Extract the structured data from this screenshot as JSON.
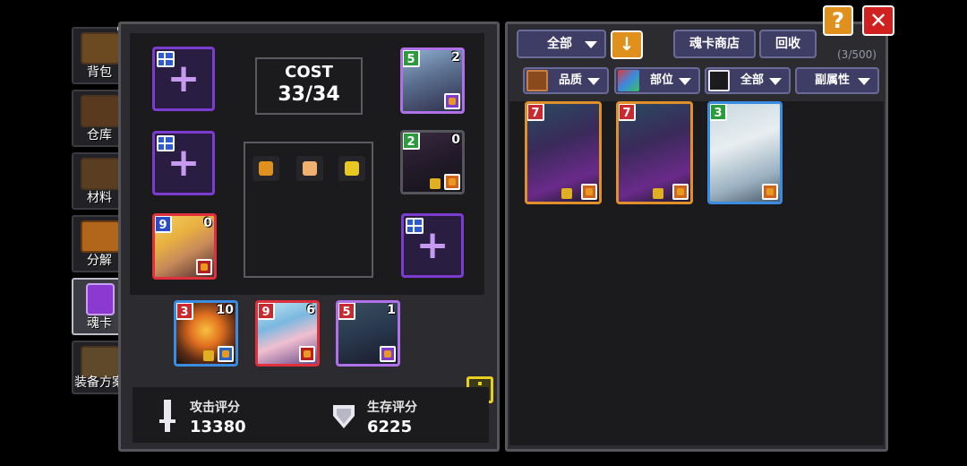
{
  "tabs": [
    {
      "label": "背包",
      "icon": "backpack-icon",
      "active": false
    },
    {
      "label": "仓库",
      "icon": "warehouse-chest-icon",
      "active": false
    },
    {
      "label": "材料",
      "icon": "materials-icon",
      "active": false
    },
    {
      "label": "分解",
      "icon": "disassemble-pot-icon",
      "active": false
    },
    {
      "label": "魂卡",
      "icon": "soul-card-icon",
      "active": true
    },
    {
      "label": "装备方案",
      "icon": "equipment-plan-icon",
      "active": false
    }
  ],
  "cost": {
    "title": "COST",
    "value": "33/34"
  },
  "equipped_cards": [
    {
      "cost": "5",
      "count": "2"
    },
    {
      "cost": "2",
      "count": "0"
    },
    {
      "cost": "9",
      "count": "0"
    },
    {
      "cost": "3",
      "count": "10"
    },
    {
      "cost": "9",
      "count": "6"
    },
    {
      "cost": "5",
      "count": "1"
    }
  ],
  "stats": {
    "attack_label": "攻击评分",
    "attack_value": "13380",
    "survival_label": "生存评分",
    "survival_value": "6225"
  },
  "toolbar": {
    "filter_all": "全部",
    "shop": "魂卡商店",
    "recycle": "回收",
    "count": "(3/500)",
    "help": "?",
    "close": "✕"
  },
  "filters": {
    "quality": "品质",
    "slot": "部位",
    "all": "全部",
    "subattr": "副属性"
  },
  "inventory_cards": [
    {
      "cost": "7"
    },
    {
      "cost": "7"
    },
    {
      "cost": "3"
    }
  ],
  "colors": {
    "accent_orange": "#e0901c",
    "close_red": "#d02020",
    "slot_purple": "#7c3cd0",
    "panel_border": "#55555c"
  }
}
